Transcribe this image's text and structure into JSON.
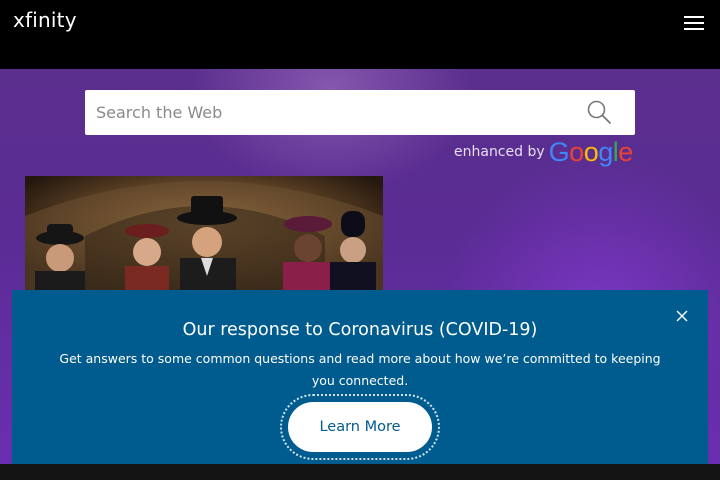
{
  "header": {
    "logo_text": "xfinity",
    "menu_icon": "hamburger-menu-icon"
  },
  "search": {
    "placeholder": "Search the Web",
    "value": "",
    "icon": "search-icon",
    "enhanced_by": "enhanced by",
    "google_logo_text": "Google"
  },
  "promo": {
    "image": "period-drama-cast-photo"
  },
  "covid_banner": {
    "title": "Our response to Coronavirus (COVID-19)",
    "body": "Get answers to some common questions and read more about how we’re committed to keeping you connected.",
    "button_label": "Learn More",
    "close_icon": "close-icon"
  },
  "colors": {
    "header_bg": "#000000",
    "hero_purple": "#5b2f8e",
    "banner_bg": "#005b8e",
    "button_text": "#005b8e"
  }
}
